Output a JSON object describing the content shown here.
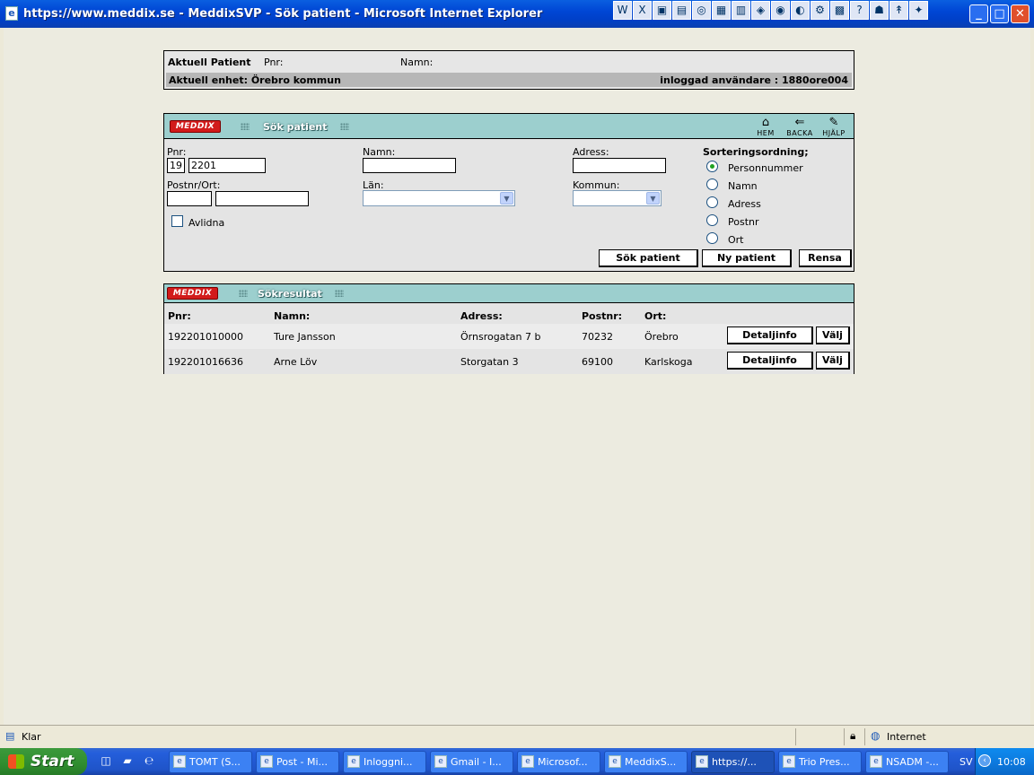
{
  "window": {
    "title": "https://www.meddix.se - MeddixSVP - Sök patient - Microsoft Internet Explorer"
  },
  "toolbar_glyphs": [
    "W",
    "X",
    "▣",
    "▤",
    "◎",
    "▦",
    "▥",
    "◈",
    "◉",
    "◐",
    "⚙",
    "▩",
    "?",
    "☗",
    "↟",
    "✦"
  ],
  "patient": {
    "label": "Aktuell Patient",
    "pnr_label": "Pnr:",
    "pnr_value": "",
    "namn_label": "Namn:",
    "namn_value": "",
    "unit": "Aktuell enhet: Örebro kommun",
    "user": "inloggad användare : 1880ore004"
  },
  "search": {
    "logo": "MEDDIX",
    "title": "Sök patient",
    "header_icons": [
      {
        "icon": "home-icon",
        "label": "HEM"
      },
      {
        "icon": "back-icon",
        "label": "BACKA"
      },
      {
        "icon": "help-icon",
        "label": "HJÄLP"
      }
    ],
    "pnr_label": "Pnr:",
    "pnr_century": "19",
    "pnr_value": "2201",
    "postnr_ort_label": "Postnr/Ort:",
    "postnr_value": "",
    "ort_value": "",
    "avlidna_label": "Avlidna",
    "avlidna_checked": false,
    "namn_label": "Namn:",
    "namn_value": "",
    "lan_label": "Län:",
    "lan_value": "",
    "adress_label": "Adress:",
    "adress_value": "",
    "kommun_label": "Kommun:",
    "kommun_value": "",
    "sort_label": "Sorteringsordning;",
    "sort_options": [
      "Personnummer",
      "Namn",
      "Adress",
      "Postnr",
      "Ort"
    ],
    "sort_selected": "Personnummer",
    "buttons": {
      "search": "Sök patient",
      "new": "Ny patient",
      "clear": "Rensa"
    }
  },
  "results": {
    "logo": "MEDDIX",
    "title": "Sökresultat",
    "headers": {
      "pnr": "Pnr:",
      "namn": "Namn:",
      "adress": "Adress:",
      "postnr": "Postnr:",
      "ort": "Ort:"
    },
    "detail_label": "Detaljinfo",
    "select_label": "Välj",
    "rows": [
      {
        "pnr": "192201010000",
        "namn": "Ture Jansson",
        "adress": "Örnsrogatan 7 b",
        "postnr": "70232",
        "ort": "Örebro"
      },
      {
        "pnr": "192201016636",
        "namn": "Arne Löv",
        "adress": "Storgatan 3",
        "postnr": "69100",
        "ort": "Karlskoga"
      }
    ]
  },
  "statusbar": {
    "status": "Klar",
    "zone": "Internet"
  },
  "taskbar": {
    "start": "Start",
    "tasks": [
      "TOMT (S...",
      "Post - Mi...",
      "Inloggni...",
      "Gmail - I...",
      "Microsof...",
      "MeddixS...",
      "https://...",
      "Trio Pres...",
      "NSADM -..."
    ],
    "active_task": 6,
    "language": "SV",
    "clock": "10:08"
  }
}
